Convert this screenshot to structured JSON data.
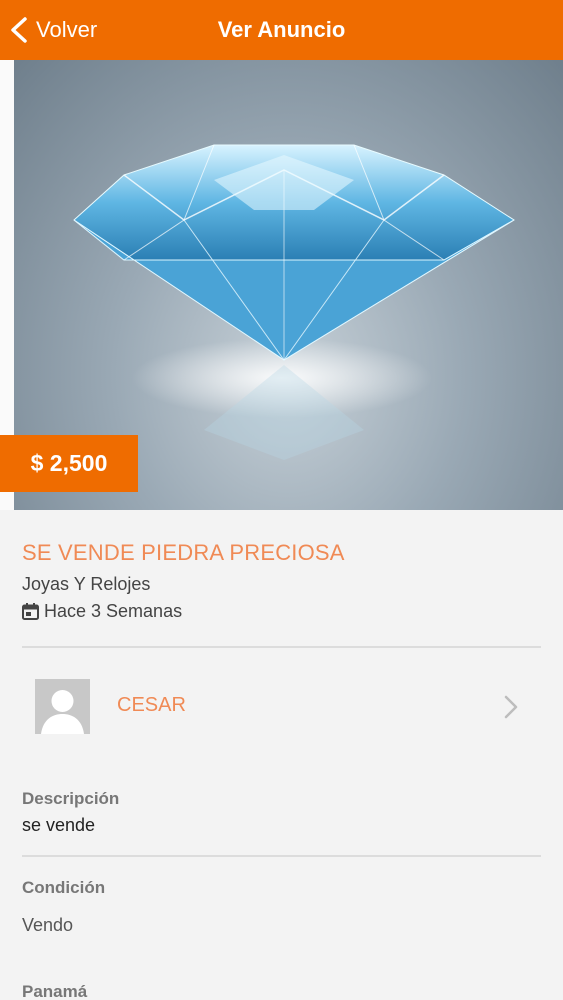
{
  "header": {
    "back_label": "Volver",
    "title": "Ver Anuncio"
  },
  "listing": {
    "price": "$ 2,500",
    "title": "SE VENDE PIEDRA PRECIOSA",
    "category": "Joyas Y Relojes",
    "posted": "Hace 3 Semanas"
  },
  "seller": {
    "name": "CESAR"
  },
  "details": {
    "description_label": "Descripción",
    "description_value": "se vende",
    "condition_label": "Condición",
    "condition_value": "Vendo",
    "location_label": "Panamá"
  },
  "colors": {
    "accent": "#ef6c00",
    "accent_text": "#f08a55"
  },
  "icons": {
    "back": "chevron-left-icon",
    "calendar": "calendar-icon",
    "avatar": "user-placeholder-icon",
    "seller_chevron": "chevron-right-icon"
  }
}
